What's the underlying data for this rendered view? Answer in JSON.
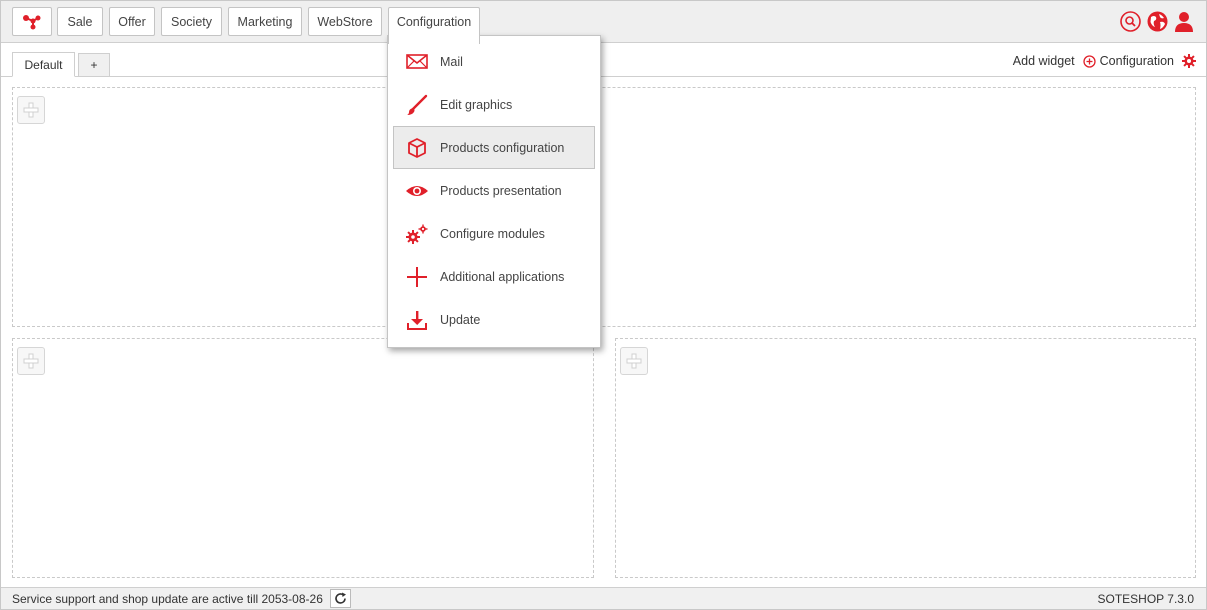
{
  "nav": {
    "logo_icon": "soteshop-logo-icon",
    "items": [
      {
        "label": "Sale"
      },
      {
        "label": "Offer"
      },
      {
        "label": "Society"
      },
      {
        "label": "Marketing"
      },
      {
        "label": "WebStore"
      },
      {
        "label": "Configuration",
        "active": true
      }
    ],
    "right_icons": [
      "search-icon",
      "globe-icon",
      "user-icon"
    ]
  },
  "tabs": {
    "items": [
      {
        "label": "Default",
        "active": true
      },
      {
        "label": "+"
      }
    ],
    "add_widget_label": "Add widget",
    "configuration_label": "Configuration"
  },
  "dropdown": {
    "items": [
      {
        "label": "Mail",
        "icon": "mail-icon"
      },
      {
        "label": "Edit graphics",
        "icon": "brush-icon"
      },
      {
        "label": "Products configuration",
        "icon": "cube-icon",
        "selected": true
      },
      {
        "label": "Products presentation",
        "icon": "eye-icon"
      },
      {
        "label": "Configure modules",
        "icon": "gears-icon"
      },
      {
        "label": "Additional applications",
        "icon": "plus-icon"
      },
      {
        "label": "Update",
        "icon": "download-icon"
      }
    ]
  },
  "footer": {
    "status": "Service support and shop update are active till 2053-08-26",
    "version": "SOTESHOP 7.3.0"
  },
  "colors": {
    "accent": "#e0202a",
    "bar_bg": "#efefef",
    "border": "#c4c4c4"
  }
}
